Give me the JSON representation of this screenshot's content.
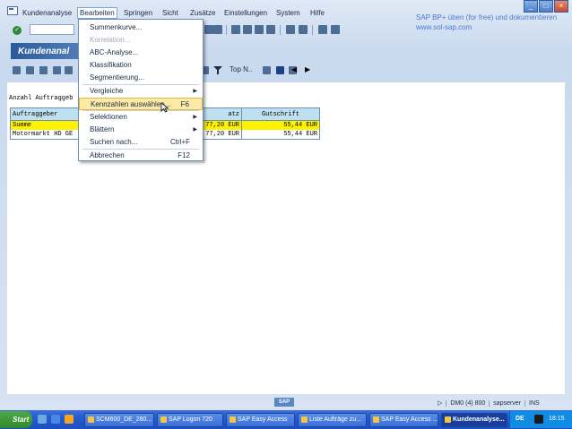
{
  "menubar": {
    "items": [
      "Kundenanalyse",
      "Bearbeiten",
      "Springen",
      "Sicht",
      "Zusätze",
      "Einstellungen",
      "System",
      "Hilfe"
    ],
    "active_index": 1
  },
  "brand": {
    "line1": "SAP BP+ üben (for free) und dokumentieren",
    "line2": "www.sol-sap.com"
  },
  "window_buttons": [
    "_",
    "□",
    "×"
  ],
  "screen_title": "Kundenanal",
  "app_toolbar": {
    "topn_label": "Top N.."
  },
  "section_label": "Anzahl Auftraggeb",
  "table": {
    "headers": [
      "Auftraggeber",
      "atz",
      "Gutschrift"
    ],
    "rows": [
      [
        "Summe",
        "77,20  EUR",
        "55,44  EUR"
      ],
      [
        "Motormarkt HD GE",
        "77,20  EUR",
        "55,44  EUR"
      ]
    ]
  },
  "dropdown": {
    "items": [
      {
        "label": "Summenkurve...",
        "shortcut": "",
        "submenu": false,
        "disabled": false
      },
      {
        "label": "Korrelation...",
        "shortcut": "",
        "submenu": false,
        "disabled": true
      },
      {
        "label": "ABC-Analyse...",
        "shortcut": "",
        "submenu": false,
        "disabled": false
      },
      {
        "label": "Klassifikation",
        "shortcut": "",
        "submenu": false,
        "disabled": false
      },
      {
        "label": "Segmentierung...",
        "shortcut": "",
        "submenu": false,
        "disabled": false
      },
      {
        "label": "Vergleiche",
        "shortcut": "",
        "submenu": true,
        "disabled": false
      },
      {
        "label": "Kennzahlen auswählen...",
        "shortcut": "F6",
        "submenu": false,
        "disabled": false
      },
      {
        "label": "Selektionen",
        "shortcut": "",
        "submenu": true,
        "disabled": false
      },
      {
        "label": "Blättern",
        "shortcut": "",
        "submenu": true,
        "disabled": false
      },
      {
        "label": "Suchen nach...",
        "shortcut": "Ctrl+F",
        "submenu": false,
        "disabled": false
      },
      {
        "label": "Abbrechen",
        "shortcut": "F12",
        "submenu": false,
        "disabled": false
      }
    ],
    "highlighted_index": 6
  },
  "status_bar": {
    "sap_logo": "SAP",
    "system": "DM0 (4) 800",
    "server": "sapserver",
    "mode": "INS"
  },
  "taskbar": {
    "start_label": "Start",
    "tasks": [
      {
        "label": "SCM600_DE_280...",
        "active": false
      },
      {
        "label": "SAP Logon 720",
        "active": false
      },
      {
        "label": "SAP Easy Access",
        "active": false
      },
      {
        "label": "Liste Aufträge zu...",
        "active": false
      },
      {
        "label": "SAP Easy Access ...",
        "active": false
      },
      {
        "label": "Kundenanalyse...",
        "active": true
      }
    ],
    "lang": "DE",
    "clock": "18:15"
  },
  "colors": {
    "highlight_yellow": "#fff200",
    "table_header": "#bfe0f0",
    "taskbar_blue": "#245bd0"
  }
}
